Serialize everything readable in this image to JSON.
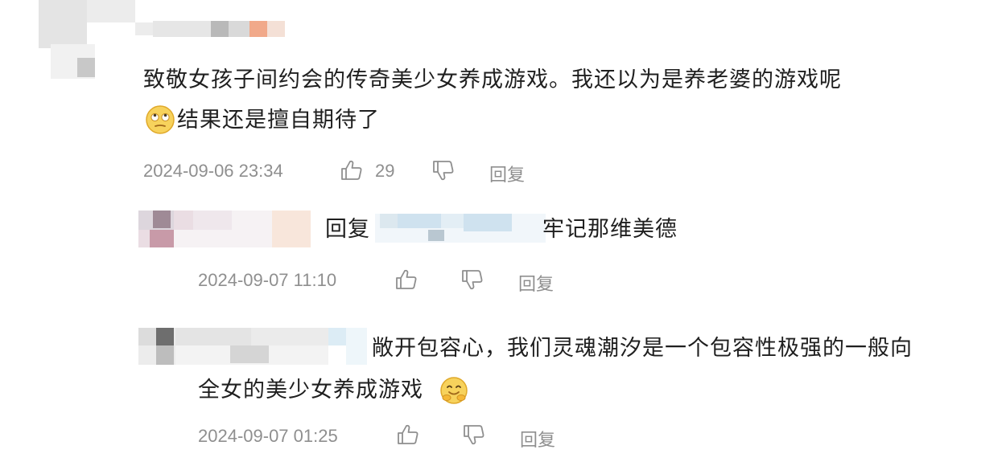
{
  "comments": [
    {
      "lines": [
        "致敬女孩子间约会的传奇美少女养成游戏。我还以为是养老婆的游戏呢",
        "结果还是擅自期待了"
      ],
      "emoji_line2": "rolling-eyes-emoji",
      "time": "2024-09-06 23:34",
      "likes": "29",
      "reply_label": "回复"
    },
    {
      "prefix": "回复",
      "text": "牢记那维美德",
      "time": "2024-09-07 11:10",
      "reply_label": "回复"
    },
    {
      "lines": [
        "敞开包容心，我们灵魂潮汐是一个包容性极强的一般向",
        "全女的美少女养成游戏"
      ],
      "emoji_line2": "hugging-face-emoji",
      "time": "2024-09-07 01:25",
      "reply_label": "回复"
    }
  ],
  "icons": {
    "like": "thumbs-up-icon",
    "dislike": "thumbs-down-icon"
  },
  "colors": {
    "meta": "#8f8f8f",
    "text": "#1f1f1f",
    "emoji": "#f5c542"
  }
}
